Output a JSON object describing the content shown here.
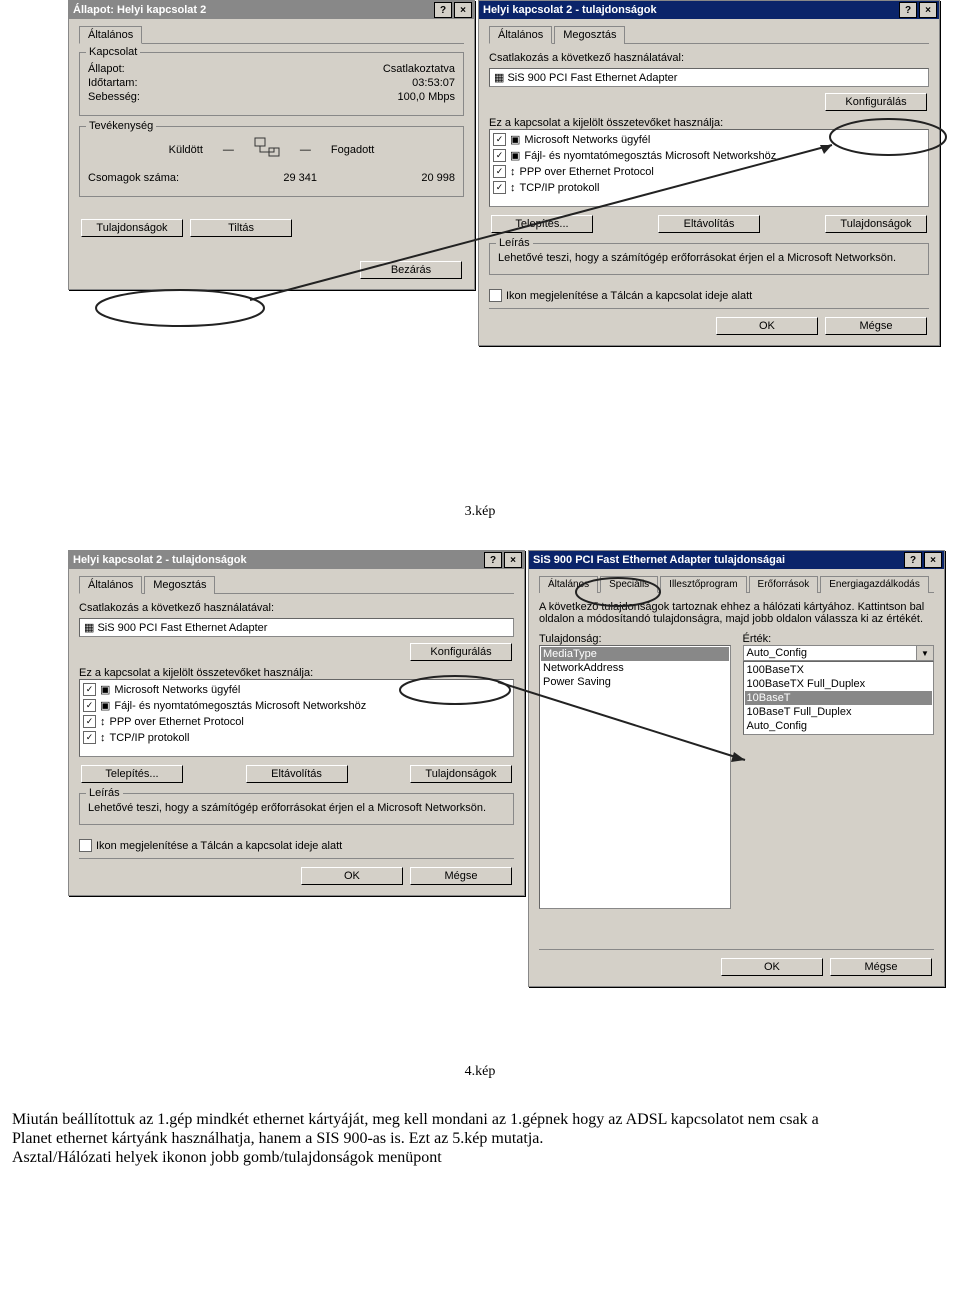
{
  "captions": {
    "c3": "3.kép",
    "c4": "4.kép"
  },
  "paragraph": {
    "l1": "Miután beállítottuk az 1.gép mindkét ethernet kártyáját, meg kell mondani az 1.gépnek hogy az ADSL kapcsolatot nem csak a",
    "l2": "Planet ethernet kártyánk használhatja, hanem a SIS 900-as is. Ezt az 5.kép mutatja.",
    "l3": "Asztal/Hálózati helyek ikonon jobb gomb/tulajdonságok menüpont"
  },
  "status": {
    "title": "Állapot: Helyi kapcsolat 2",
    "tab": "Általános",
    "grp_conn": "Kapcsolat",
    "f_status": "Állapot:",
    "v_status": "Csatlakoztatva",
    "f_dur": "Időtartam:",
    "v_dur": "03:53:07",
    "f_speed": "Sebesség:",
    "v_speed": "100,0 Mbps",
    "grp_act": "Tevékenység",
    "sent": "Küldött",
    "recv": "Fogadott",
    "f_packets": "Csomagok száma:",
    "v_sent": "29 341",
    "v_recv": "20 998",
    "btn_props": "Tulajdonságok",
    "btn_disable": "Tiltás",
    "btn_close": "Bezárás"
  },
  "props": {
    "title": "Helyi kapcsolat 2 - tulajdonságok",
    "tab1": "Általános",
    "tab2": "Megosztás",
    "lbl_connect": "Csatlakozás a következő használatával:",
    "adapter": "SiS 900 PCI Fast Ethernet Adapter",
    "btn_conf": "Konfigurálás",
    "lbl_items": "Ez a kapcsolat a kijelölt összetevőket használja:",
    "items": [
      "Microsoft Networks ügyfél",
      "Fájl- és nyomtatómegosztás Microsoft Networkshöz",
      "PPP over Ethernet Protocol",
      "TCP/IP protokoll"
    ],
    "btn_install": "Telepítés...",
    "btn_remove": "Eltávolítás",
    "btn_props": "Tulajdonságok",
    "grp_desc": "Leírás",
    "desc": "Lehetővé teszi, hogy a számítógép erőforrásokat érjen el a Microsoft Networksön.",
    "showicon": "Ikon megjelenítése a Tálcán a kapcsolat ideje alatt",
    "ok": "OK",
    "cancel": "Mégse"
  },
  "sis": {
    "title": "SiS 900 PCI Fast Ethernet Adapter tulajdonságai",
    "tabs": [
      "Általános",
      "Speciális",
      "Illesztőprogram",
      "Erőforrások",
      "Energiagazdálkodás"
    ],
    "desc": "A következő tulajdonságok tartoznak ehhez a hálózati kártyához. Kattintson bal oldalon a módosítandó tulajdonságra, majd jobb oldalon válassza ki az értékét.",
    "lbl_prop": "Tulajdonság:",
    "lbl_val": "Érték:",
    "proplist": [
      "MediaType",
      "NetworkAddress",
      "Power Saving"
    ],
    "value": "Auto_Config",
    "options": [
      "100BaseTX",
      "100BaseTX Full_Duplex",
      "10BaseT",
      "10BaseT Full_Duplex",
      "Auto_Config"
    ],
    "ok": "OK",
    "cancel": "Mégse"
  }
}
